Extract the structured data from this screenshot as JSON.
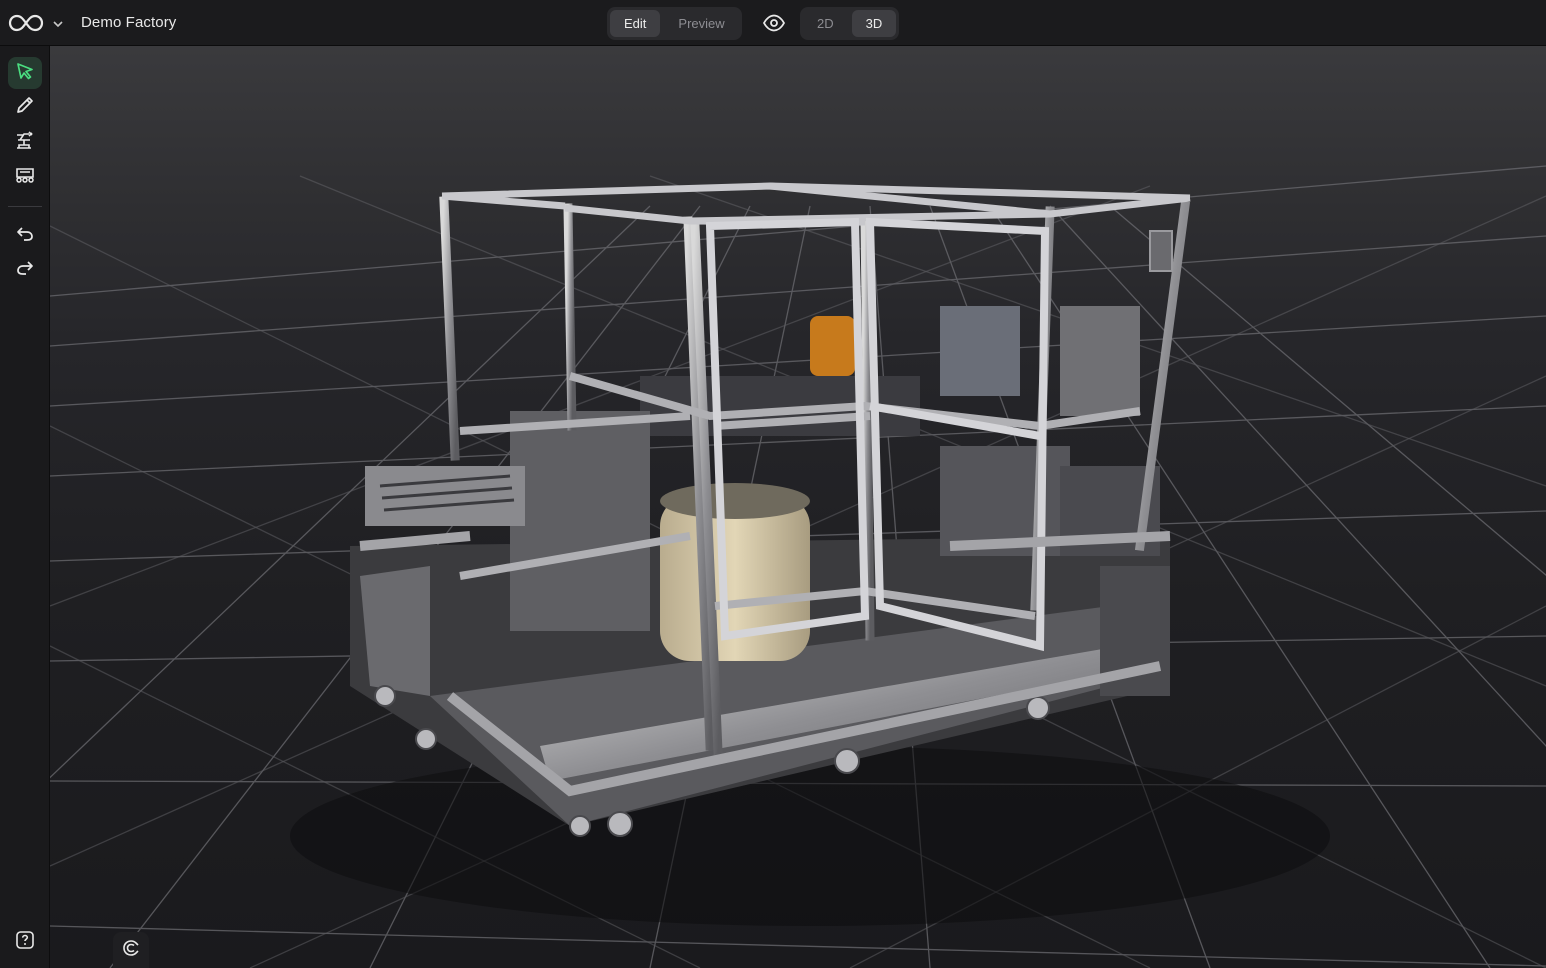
{
  "app": {
    "title": "Demo Factory",
    "logo_icon": "infinity-logo-icon",
    "logo_menu_icon": "chevron-down-icon"
  },
  "mode_toggle": {
    "options": [
      "Edit",
      "Preview"
    ],
    "selected": "Edit"
  },
  "visibility_icon": "eye-icon",
  "view_toggle": {
    "options": [
      "2D",
      "3D"
    ],
    "selected": "3D"
  },
  "toolbar": {
    "tools": [
      {
        "name": "select-tool",
        "icon": "cursor-arrow-icon",
        "active": true
      },
      {
        "name": "draw-tool",
        "icon": "pencil-icon",
        "active": false
      },
      {
        "name": "machine-tool",
        "icon": "robot-arm-icon",
        "active": false
      },
      {
        "name": "vehicle-tool",
        "icon": "vehicle-icon",
        "active": false
      }
    ],
    "history": [
      {
        "name": "undo-button",
        "icon": "undo-icon"
      },
      {
        "name": "redo-button",
        "icon": "redo-icon"
      }
    ]
  },
  "viewport_controls": [
    {
      "name": "snap-magnet-button",
      "icon": "magnet-icon"
    },
    {
      "name": "fit-view-button",
      "icon": "frame-icon"
    }
  ],
  "help_icon": "help-icon",
  "colors": {
    "accent": "#4ade80",
    "background": "#161618",
    "active_segment": "#3e3e42"
  }
}
